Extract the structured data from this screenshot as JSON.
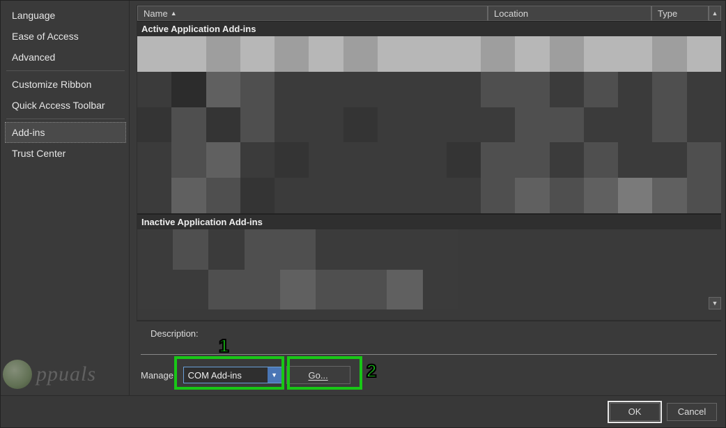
{
  "sidebar": {
    "items": [
      {
        "label": "Language"
      },
      {
        "label": "Ease of Access"
      },
      {
        "label": "Advanced"
      },
      {
        "label": "Customize Ribbon"
      },
      {
        "label": "Quick Access Toolbar"
      },
      {
        "label": "Add-ins"
      },
      {
        "label": "Trust Center"
      }
    ],
    "selected_index": 5
  },
  "columns": {
    "name": "Name",
    "location": "Location",
    "type": "Type"
  },
  "sections": {
    "active_header": "Active Application Add-ins",
    "inactive_header": "Inactive Application Add-ins"
  },
  "description_label": "Description:",
  "manage": {
    "label": "Manage:",
    "selected": "COM Add-ins",
    "go_label": "Go..."
  },
  "footer": {
    "ok": "OK",
    "cancel": "Cancel"
  },
  "callouts": {
    "one": "1",
    "two": "2"
  },
  "watermark": {
    "text": "ppuals"
  }
}
